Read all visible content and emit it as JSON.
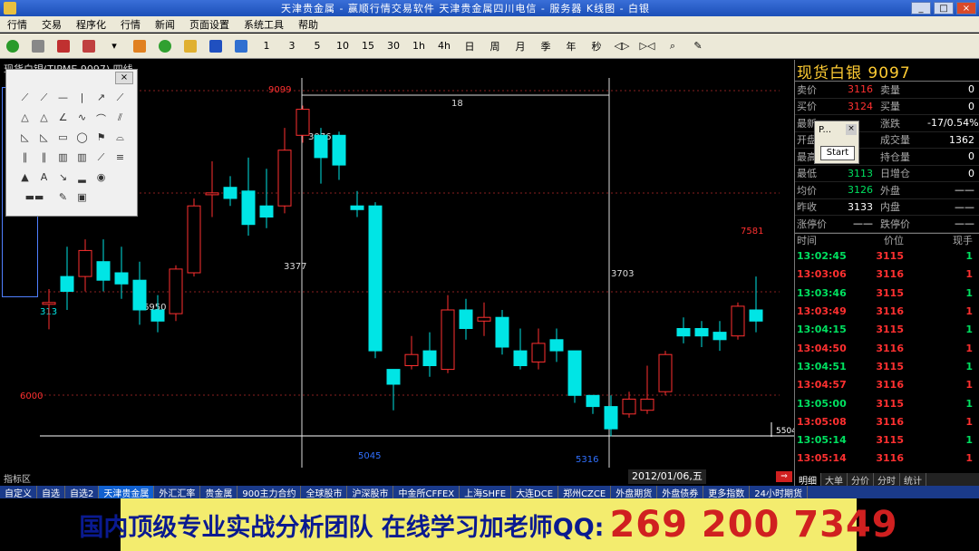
{
  "window": {
    "title": "天津贵金属 - 赢顺行情交易软件     天津贵金属四川电信 - 服务器     K线图 - 白银",
    "minimize": "_",
    "maximize": "□",
    "close": "×"
  },
  "menu": [
    "行情",
    "交易",
    "程序化",
    "行情",
    "新闻",
    "页面设置",
    "系统工具",
    "帮助"
  ],
  "toolbar": {
    "periods": [
      "1",
      "3",
      "5",
      "10",
      "15",
      "30",
      "1h",
      "4h",
      "日",
      "周",
      "月",
      "季",
      "年",
      "秒"
    ]
  },
  "chart": {
    "header": "现货白银(TJPME 9097) 四线",
    "price_label_top": "9099",
    "price_label_6000": "6000",
    "price_label_right": "5504",
    "ann_18": "18",
    "ann_3377": "3377",
    "ann_3703": "3703",
    "ann_6950": "6950",
    "ann_3076": "3076",
    "ann_313": "313",
    "ann_7581": "7581",
    "ann_5045": "5045",
    "ann_5316": "5316",
    "date": "2012/01/06,五",
    "index_label": "指标区"
  },
  "chart_data": {
    "type": "candlestick",
    "candles": [
      {
        "o": 4180,
        "c": 4200,
        "h": 4560,
        "l": 3480
      },
      {
        "o": 4900,
        "c": 4500,
        "h": 5700,
        "l": 4000
      },
      {
        "o": 4900,
        "c": 5600,
        "h": 5900,
        "l": 4500
      },
      {
        "o": 5300,
        "c": 4800,
        "h": 5900,
        "l": 4500
      },
      {
        "o": 5000,
        "c": 4700,
        "h": 5700,
        "l": 4300
      },
      {
        "o": 4800,
        "c": 4000,
        "h": 5300,
        "l": 3600
      },
      {
        "o": 4000,
        "c": 3700,
        "h": 4400,
        "l": 3400
      },
      {
        "o": 3900,
        "c": 5100,
        "h": 5200,
        "l": 3700
      },
      {
        "o": 5000,
        "c": 6800,
        "h": 7000,
        "l": 4900
      },
      {
        "o": 7100,
        "c": 7150,
        "h": 8000,
        "l": 6500
      },
      {
        "o": 7300,
        "c": 7000,
        "h": 7600,
        "l": 6800
      },
      {
        "o": 7200,
        "c": 6300,
        "h": 8100,
        "l": 6000
      },
      {
        "o": 6800,
        "c": 6500,
        "h": 7800,
        "l": 6200
      },
      {
        "o": 6800,
        "c": 8300,
        "h": 8900,
        "l": 6600
      },
      {
        "o": 8700,
        "c": 9400,
        "h": 9500,
        "l": 8500
      },
      {
        "o": 8700,
        "c": 8100,
        "h": 8900,
        "l": 7400
      },
      {
        "o": 8700,
        "c": 7900,
        "h": 8800,
        "l": 7500
      },
      {
        "o": 6800,
        "c": 6700,
        "h": 7200,
        "l": 6500
      },
      {
        "o": 6800,
        "c": 2900,
        "h": 6900,
        "l": 2700
      },
      {
        "o": 2400,
        "c": 2000,
        "h": 2400,
        "l": 1300
      },
      {
        "o": 2500,
        "c": 2800,
        "h": 3300,
        "l": 2400
      },
      {
        "o": 2900,
        "c": 2500,
        "h": 3400,
        "l": 2200
      },
      {
        "o": 2400,
        "c": 4000,
        "h": 4400,
        "l": 2300
      },
      {
        "o": 4000,
        "c": 3500,
        "h": 4300,
        "l": 3200
      },
      {
        "o": 3700,
        "c": 3800,
        "h": 4200,
        "l": 3300
      },
      {
        "o": 3800,
        "c": 3000,
        "h": 4000,
        "l": 2800
      },
      {
        "o": 2900,
        "c": 2500,
        "h": 3500,
        "l": 2400
      },
      {
        "o": 2600,
        "c": 3100,
        "h": 3500,
        "l": 2400
      },
      {
        "o": 3200,
        "c": 2900,
        "h": 3500,
        "l": 2600
      },
      {
        "o": 2900,
        "c": 1700,
        "h": 2900,
        "l": 1500
      },
      {
        "o": 1700,
        "c": 1400,
        "h": 1700,
        "l": 1200
      },
      {
        "o": 1400,
        "c": 800,
        "h": 1700,
        "l": 600
      },
      {
        "o": 1200,
        "c": 1600,
        "h": 1800,
        "l": 1100
      },
      {
        "o": 1300,
        "c": 1600,
        "h": 2500,
        "l": 1200
      },
      {
        "o": 1800,
        "c": 2800,
        "h": 2900,
        "l": 1700
      },
      {
        "o": 3500,
        "c": 3300,
        "h": 3800,
        "l": 3100
      },
      {
        "o": 3500,
        "c": 3300,
        "h": 3700,
        "l": 3000
      },
      {
        "o": 3400,
        "c": 3200,
        "h": 3700,
        "l": 2900
      },
      {
        "o": 3300,
        "c": 4100,
        "h": 4200,
        "l": 3200
      },
      {
        "o": 4000,
        "c": 3700,
        "h": 4900,
        "l": 3400
      }
    ]
  },
  "quote": {
    "title": "现货白银  9097",
    "rows": [
      {
        "l1": "卖价",
        "v1": "3116",
        "v1c": "red",
        "l2": "卖量",
        "v2": "0",
        "v2c": "red"
      },
      {
        "l1": "买价",
        "v1": "3124",
        "v1c": "red",
        "l2": "买量",
        "v2": "0",
        "v2c": "red"
      },
      {
        "l1": "最新",
        "v1": "",
        "v1c": "red",
        "l2": "涨跌",
        "v2": "-17/0.54%",
        "v2c": "green"
      },
      {
        "l1": "开盘",
        "v1": "",
        "v1c": "red",
        "l2": "成交量",
        "v2": "1362",
        "v2c": "white"
      },
      {
        "l1": "最高",
        "v1": "",
        "v1c": "red",
        "l2": "持仓量",
        "v2": "0",
        "v2c": "white"
      },
      {
        "l1": "最低",
        "v1": "3113",
        "v1c": "green",
        "l2": "日增仓",
        "v2": "0",
        "v2c": "white"
      },
      {
        "l1": "均价",
        "v1": "3126",
        "v1c": "green",
        "l2": "外盘",
        "v2": "——",
        "v2c": "white"
      },
      {
        "l1": "昨收",
        "v1": "3133",
        "v1c": "white",
        "l2": "内盘",
        "v2": "——",
        "v2c": "white"
      },
      {
        "l1": "涨停价",
        "v1": "——",
        "v1c": "white",
        "l2": "跌停价",
        "v2": "——",
        "v2c": "white"
      }
    ],
    "trade_header": {
      "t": "时间",
      "p": "价位",
      "q": "现手"
    },
    "trades": [
      {
        "t": "13:02:45",
        "p": "3115",
        "q": "1",
        "c": "green"
      },
      {
        "t": "13:03:06",
        "p": "3116",
        "q": "1",
        "c": "red"
      },
      {
        "t": "13:03:46",
        "p": "3115",
        "q": "1",
        "c": "green"
      },
      {
        "t": "13:03:49",
        "p": "3116",
        "q": "1",
        "c": "red"
      },
      {
        "t": "13:04:15",
        "p": "3115",
        "q": "1",
        "c": "green"
      },
      {
        "t": "13:04:50",
        "p": "3116",
        "q": "1",
        "c": "red"
      },
      {
        "t": "13:04:51",
        "t2": "",
        "p": "3115",
        "q": "1",
        "c": "green"
      },
      {
        "t": "13:04:57",
        "p": "3116",
        "q": "1",
        "c": "red"
      },
      {
        "t": "13:05:00",
        "p": "3115",
        "q": "1",
        "c": "green"
      },
      {
        "t": "13:05:08",
        "p": "3116",
        "q": "1",
        "c": "red"
      },
      {
        "t": "13:05:14",
        "p": "3115",
        "q": "1",
        "c": "green"
      },
      {
        "t": "13:05:14",
        "p": "3116",
        "q": "1",
        "c": "red"
      }
    ],
    "tabs": [
      "明细",
      "大单",
      "分价",
      "分时",
      "统计"
    ]
  },
  "popup": {
    "title": "P...",
    "close": "×",
    "start": "Start"
  },
  "palette": {
    "close": "×"
  },
  "bottom_tabs": [
    "自定义",
    "自选",
    "自选2",
    "天津贵金属",
    "外汇汇率",
    "贵金属",
    "900主力合约",
    "全球股市",
    "沪深股市",
    "中金所CFFEX",
    "上海SHFE",
    "大连DCE",
    "郑州CZCE",
    "外盘期货",
    "外盘债券",
    "更多指数",
    "24小时期货"
  ],
  "banner": {
    "text1": "国内顶级专业实战分析团队 在线学习加老师QQ:",
    "text2": "269 200 7349"
  }
}
